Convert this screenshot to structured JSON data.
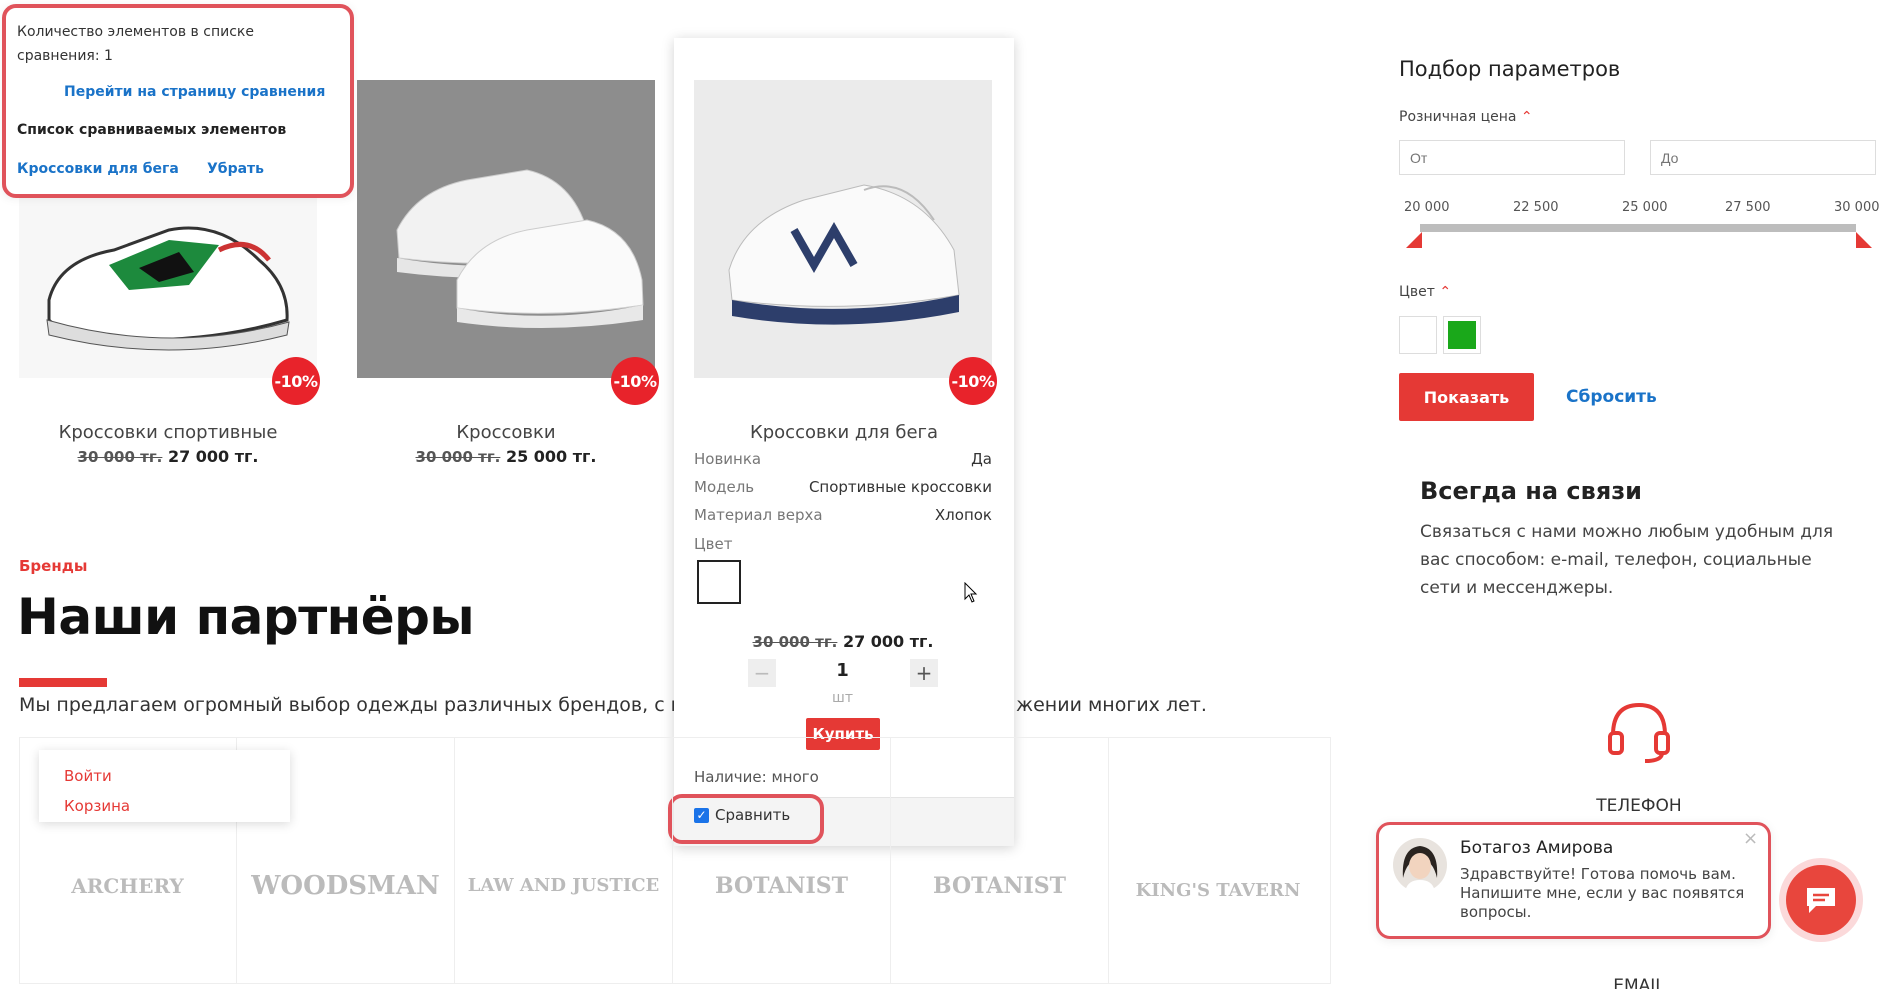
{
  "compare_popup": {
    "count_text": "Количество элементов в списке сравнения: 1",
    "go_link": "Перейти на страницу сравнения",
    "list_title": "Список сравниваемых элементов",
    "item_name": "Кроссовки для бега",
    "remove_link": "Убрать"
  },
  "products": [
    {
      "name": "Кроссовки спортивные",
      "old_price": "30 000 тг.",
      "price": "27 000 тг.",
      "discount": "-10%"
    },
    {
      "name": "Кроссовки",
      "old_price": "30 000 тг.",
      "price": "25 000 тг.",
      "discount": "-10%"
    },
    {
      "name": "Кроссовки для бега",
      "old_price": "30 000 тг.",
      "price": "27 000 тг.",
      "discount": "-10%"
    }
  ],
  "expanded_card": {
    "props": [
      {
        "label": "Новинка",
        "value": "Да"
      },
      {
        "label": "Модель",
        "value": "Спортивные кроссовки"
      },
      {
        "label": "Материал верха",
        "value": "Хлопок"
      }
    ],
    "color_label": "Цвет",
    "qty": "1",
    "unit": "шт",
    "buy_label": "Купить",
    "availability": "Наличие: много",
    "compare_label": "Сравнить",
    "minus": "−",
    "plus": "+"
  },
  "brands": {
    "eyebrow": "Бренды",
    "title": "Наши партнёры",
    "desc_left": "Мы предлагаем огромный выбор одежды различных брендов, с к",
    "desc_right": "жении многих лет.",
    "logos": [
      "ARCHERY",
      "WOODSMAN",
      "LAW AND JUSTICE",
      "BOTANIST",
      "BOTANIST",
      "KING'S TAVERN"
    ]
  },
  "user_menu": {
    "login": "Войти",
    "cart": "Корзина"
  },
  "filter": {
    "title": "Подбор параметров",
    "price_label": "Розничная цена",
    "from_placeholder": "От",
    "to_placeholder": "До",
    "ticks": [
      "20 000",
      "22 500",
      "25 000",
      "27 500",
      "30 000"
    ],
    "color_label": "Цвет",
    "colors": [
      "#ffffff",
      "#1aa81a"
    ],
    "show_button": "Показать",
    "reset_link": "Сбросить"
  },
  "contact": {
    "title": "Всегда на связи",
    "text": "Связаться с нами можно любым удобным для вас способом: e-mail, телефон, социальные сети и мессенджеры.",
    "phone_label": "ТЕЛЕФОН",
    "email_label": "EMAIL"
  },
  "chat": {
    "name": "Ботагоз Амирова",
    "message": "Здравствуйте! Готова помочь вам. Напишите мне, если у вас появятся вопросы.",
    "close": "×"
  },
  "colors": {
    "accent": "#e53935",
    "link": "#1a73c8"
  }
}
